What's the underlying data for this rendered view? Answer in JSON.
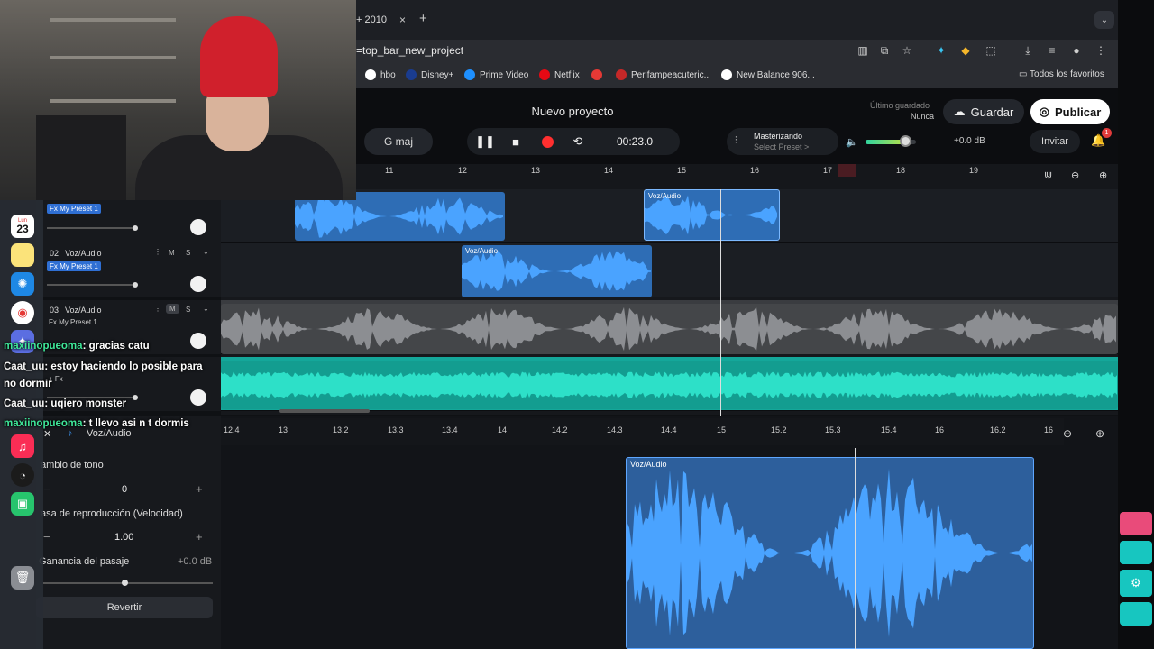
{
  "browser": {
    "tab_title": "+ 2010",
    "tab_close": "×",
    "new_tab": "+",
    "url": "=top_bar_new_project",
    "bookmarks": [
      {
        "label": "hbo",
        "color": "#ffffff"
      },
      {
        "label": "Disney+",
        "color": "#1a3c8f"
      },
      {
        "label": "Prime Video",
        "color": "#1e90ff"
      },
      {
        "label": "Netflix",
        "color": "#e50914"
      },
      {
        "label": "",
        "color": "#e53935"
      },
      {
        "label": "Perifampeacuteric...",
        "color": "#c62828"
      },
      {
        "label": "New Balance 906...",
        "color": "#ffffff"
      }
    ],
    "all_favorites": "Todos los favoritos"
  },
  "app": {
    "project_title": "Nuevo proyecto",
    "key": "G maj",
    "time": "00:23.0",
    "mastering_title": "Masterizando",
    "mastering_preset": "Select Preset >",
    "volume_db": "+0.0 dB",
    "volume_level": 0.78,
    "last_saved_label": "Último guardado",
    "last_saved_value": "Nunca",
    "save_label": "Guardar",
    "publish_label": "Publicar",
    "invite_label": "Invitar",
    "notifications": "1"
  },
  "ruler": {
    "numbers": [
      "11",
      "12",
      "13",
      "14",
      "15",
      "16",
      "17",
      "18",
      "19"
    ]
  },
  "tracks": [
    {
      "number": "",
      "name": "",
      "fx": "Fx My Preset 1",
      "fx_active": true,
      "clip_label": "Voz/Audio"
    },
    {
      "number": "02",
      "name": "Voz/Audio",
      "fx": "Fx My Preset 1",
      "fx_active": true,
      "mute": "M",
      "solo": "S",
      "clip_label": "Voz/Audio"
    },
    {
      "number": "03",
      "name": "Voz/Audio",
      "fx": "Fx My Preset 1",
      "fx_active": false,
      "mute": "M",
      "solo": "S"
    },
    {
      "number": "",
      "name": "",
      "fx": "+ Fx",
      "fx_active": false
    }
  ],
  "chat": [
    {
      "user": "maxiinopueoma",
      "text": ": gracias catu",
      "user_color": "#3fe89a"
    },
    {
      "user": "Caat_uu",
      "text": ": estoy haciendo lo posible para",
      "user_color": "#f4f4f4"
    },
    {
      "user": "",
      "text": "no dormir",
      "user_color": "#f4f4f4"
    },
    {
      "user": "Caat_uu",
      "text": ": uqiero monster",
      "user_color": "#f4f4f4"
    },
    {
      "user": "maxiinopueoma",
      "text": ": t llevo asi n t dormis",
      "user_color": "#3fe89a"
    }
  ],
  "dock": {
    "calendar_day": "23",
    "calendar_month": "Lun"
  },
  "editor": {
    "track_label": "Voz/Audio",
    "lower_ruler": [
      "12.4",
      "13",
      "13.2",
      "13.3",
      "13.4",
      "14",
      "14.2",
      "14.3",
      "14.4",
      "15",
      "15.2",
      "15.3",
      "15.4",
      "16",
      "16.2",
      "16"
    ],
    "pitch_label": "ambio de tono",
    "pitch_value": "0",
    "speed_label": "asa de reproducción (Velocidad)",
    "speed_value": "1.00",
    "gain_label": "Ganancia del pasaje",
    "gain_value": "+0.0 dB",
    "revert_label": "Revertir",
    "clip_label": "Voz/Audio"
  },
  "accent": "#3b8fe8"
}
